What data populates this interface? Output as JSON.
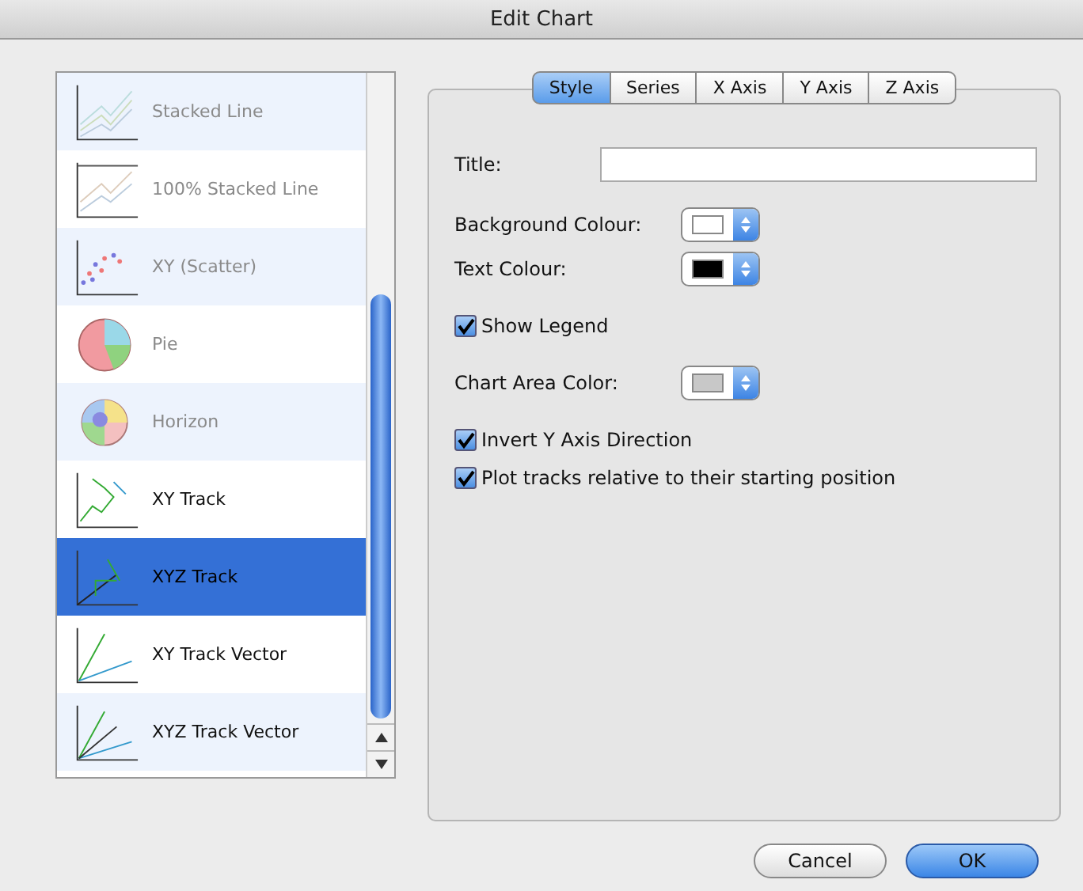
{
  "window": {
    "title": "Edit Chart"
  },
  "chart_types": [
    {
      "label": "Stacked Line",
      "kind": "stacked-line",
      "disabled": true,
      "selected": false
    },
    {
      "label": "100% Stacked Line",
      "kind": "percent-line",
      "disabled": true,
      "selected": false
    },
    {
      "label": "XY (Scatter)",
      "kind": "scatter",
      "disabled": true,
      "selected": false
    },
    {
      "label": "Pie",
      "kind": "pie",
      "disabled": true,
      "selected": false
    },
    {
      "label": "Horizon",
      "kind": "horizon",
      "disabled": true,
      "selected": false
    },
    {
      "label": "XY Track",
      "kind": "track",
      "disabled": false,
      "selected": false
    },
    {
      "label": "XYZ Track",
      "kind": "track3d",
      "disabled": false,
      "selected": true
    },
    {
      "label": "XY Track Vector",
      "kind": "vector",
      "disabled": false,
      "selected": false
    },
    {
      "label": "XYZ Track Vector",
      "kind": "vector3d",
      "disabled": false,
      "selected": false
    }
  ],
  "tabs": [
    {
      "label": "Style",
      "selected": true
    },
    {
      "label": "Series",
      "selected": false
    },
    {
      "label": "X Axis",
      "selected": false
    },
    {
      "label": "Y Axis",
      "selected": false
    },
    {
      "label": "Z Axis",
      "selected": false
    }
  ],
  "options": [
    {
      "kind": "text",
      "label": "Title:"
    },
    {
      "kind": "color",
      "label": "Background Colour:",
      "color": "#ffffff"
    },
    {
      "kind": "color",
      "label": "Text Colour:",
      "color": "#000000"
    },
    {
      "kind": "checkbox",
      "label": "Show Legend",
      "checked": true
    },
    {
      "kind": "color",
      "label": "Chart Area Color:",
      "color": "#c8c8c8"
    },
    {
      "kind": "checkbox",
      "label": "Invert Y Axis Direction",
      "checked": true
    },
    {
      "kind": "checkbox",
      "label": "Plot tracks relative to their starting position",
      "checked": true
    }
  ],
  "buttons": [
    {
      "label": "Cancel",
      "default": false
    },
    {
      "label": "OK",
      "default": true
    }
  ]
}
